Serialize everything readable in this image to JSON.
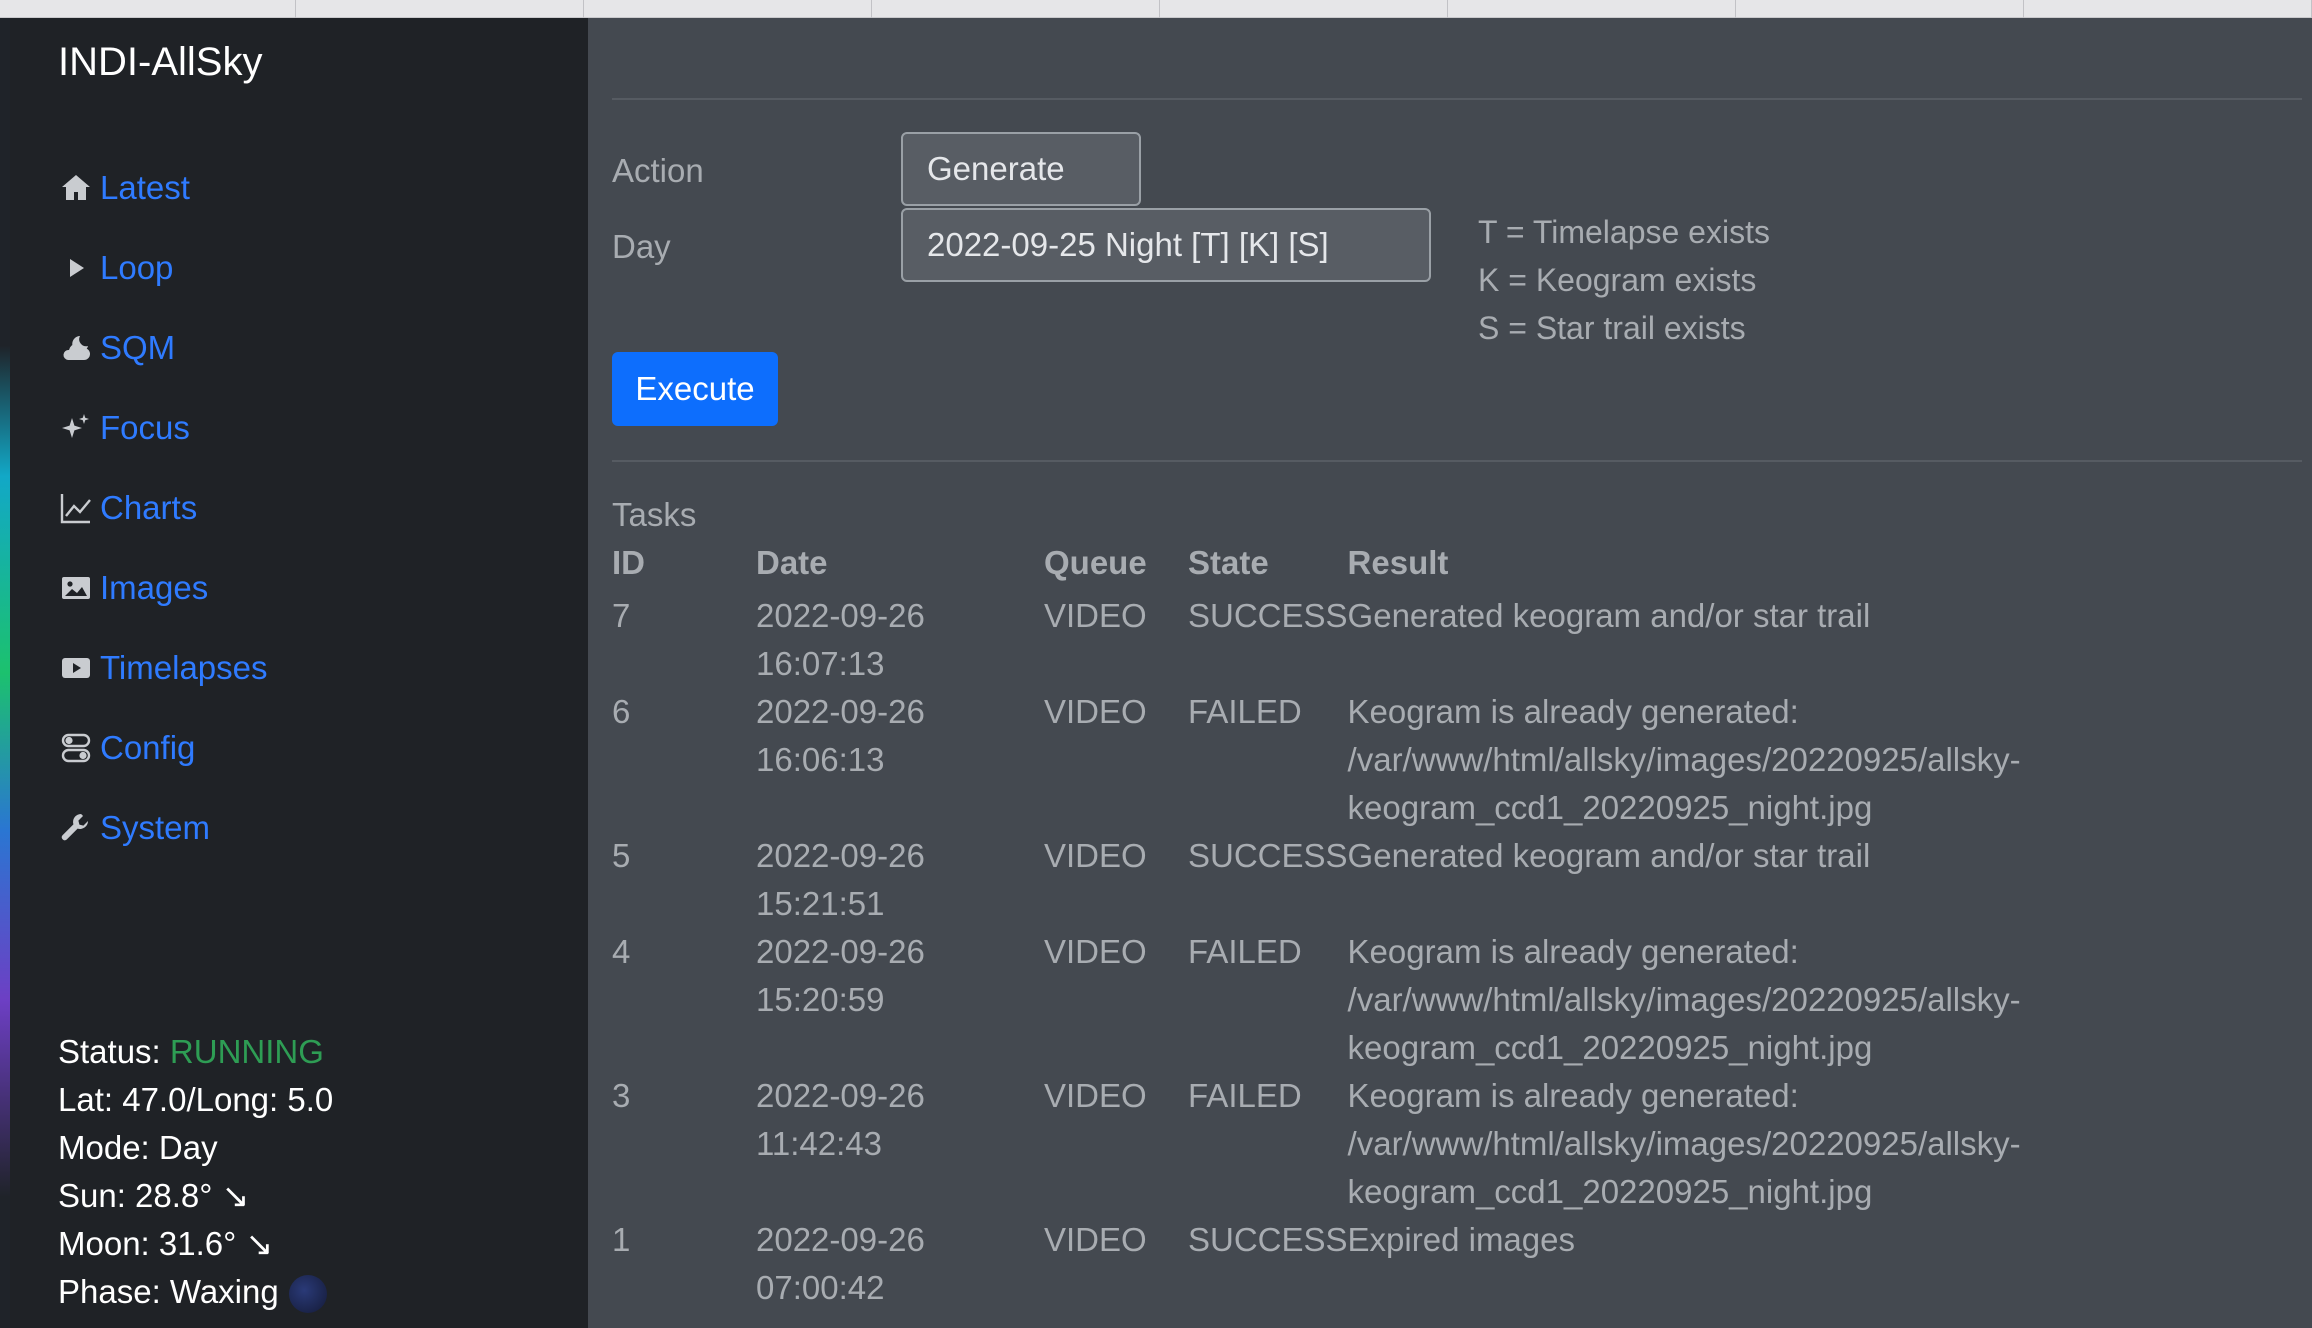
{
  "app": {
    "brand": "INDI-AllSky"
  },
  "nav": [
    {
      "label": "Latest",
      "icon": "house-icon"
    },
    {
      "label": "Loop",
      "icon": "play-triangle-icon"
    },
    {
      "label": "SQM",
      "icon": "cloud-moon-icon"
    },
    {
      "label": "Focus",
      "icon": "stars-icon"
    },
    {
      "label": "Charts",
      "icon": "line-chart-icon"
    },
    {
      "label": "Images",
      "icon": "image-icon"
    },
    {
      "label": "Timelapses",
      "icon": "video-play-icon"
    },
    {
      "label": "Config",
      "icon": "toggles-icon"
    },
    {
      "label": "System",
      "icon": "wrench-icon"
    }
  ],
  "status": {
    "status_label": "Status:",
    "status_value": "RUNNING",
    "latlong": "Lat: 47.0/Long: 5.0",
    "mode": "Mode: Day",
    "sun": "Sun: 28.8° ↘",
    "moon": "Moon: 31.6° ↘",
    "phase": "Phase: Waxing"
  },
  "form": {
    "action_label": "Action",
    "action_value": "Generate",
    "day_label": "Day",
    "day_value": "2022-09-25 Night [T] [K] [S]",
    "legend": [
      "T = Timelapse exists",
      "K = Keogram exists",
      "S = Star trail exists"
    ],
    "execute_label": "Execute"
  },
  "tasks": {
    "title": "Tasks",
    "headers": {
      "id": "ID",
      "date": "Date",
      "queue": "Queue",
      "state": "State",
      "result": "Result"
    },
    "rows": [
      {
        "id": "7",
        "date1": "2022-09-26",
        "date2": "16:07:13",
        "queue": "VIDEO",
        "state": "SUCCESS",
        "r1": "Generated keogram and/or star trail",
        "r2": "",
        "r3": ""
      },
      {
        "id": "6",
        "date1": "2022-09-26",
        "date2": "16:06:13",
        "queue": "VIDEO",
        "state": "FAILED",
        "r1": "Keogram is already generated:",
        "r2": "/var/www/html/allsky/images/20220925/allsky-",
        "r3": "keogram_ccd1_20220925_night.jpg"
      },
      {
        "id": "5",
        "date1": "2022-09-26",
        "date2": "15:21:51",
        "queue": "VIDEO",
        "state": "SUCCESS",
        "r1": "Generated keogram and/or star trail",
        "r2": "",
        "r3": ""
      },
      {
        "id": "4",
        "date1": "2022-09-26",
        "date2": "15:20:59",
        "queue": "VIDEO",
        "state": "FAILED",
        "r1": "Keogram is already generated:",
        "r2": "/var/www/html/allsky/images/20220925/allsky-",
        "r3": "keogram_ccd1_20220925_night.jpg"
      },
      {
        "id": "3",
        "date1": "2022-09-26",
        "date2": "11:42:43",
        "queue": "VIDEO",
        "state": "FAILED",
        "r1": "Keogram is already generated:",
        "r2": "/var/www/html/allsky/images/20220925/allsky-",
        "r3": "keogram_ccd1_20220925_night.jpg"
      },
      {
        "id": "1",
        "date1": "2022-09-26",
        "date2": "07:00:42",
        "queue": "VIDEO",
        "state": "SUCCESS",
        "r1": "Expired images",
        "r2": "",
        "r3": ""
      }
    ]
  }
}
